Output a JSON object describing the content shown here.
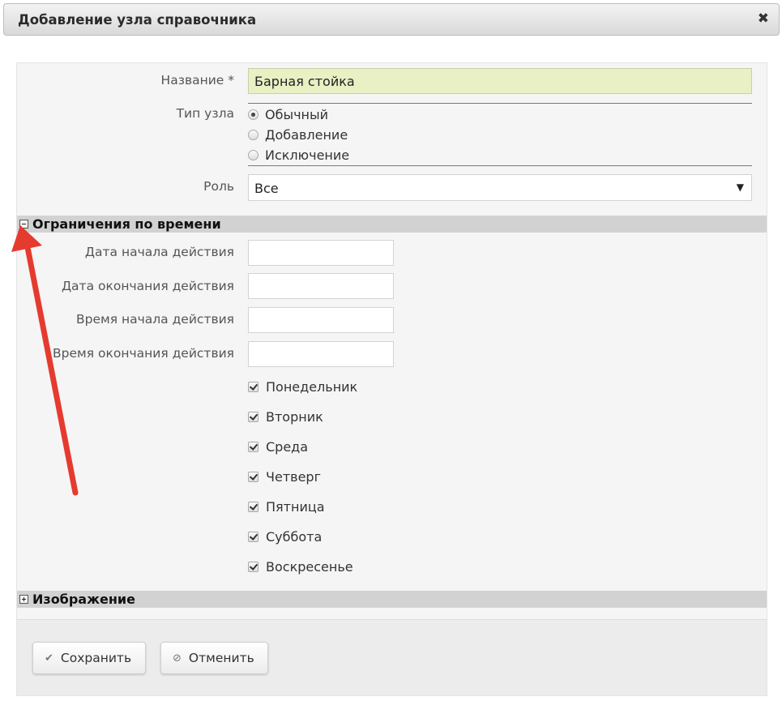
{
  "dialog": {
    "title": "Добавление узла справочника",
    "close_glyph": "✖"
  },
  "form": {
    "name_label": "Название *",
    "name_value": "Барная стойка",
    "node_type_label": "Тип узла",
    "node_type_options": [
      "Обычный",
      "Добавление",
      "Исключение"
    ],
    "node_type_selected": "Обычный",
    "role_label": "Роль",
    "role_value": "Все"
  },
  "time_section": {
    "title": "Ограничения по времени",
    "expanded": true,
    "start_date_label": "Дата начала действия",
    "end_date_label": "Дата окончания действия",
    "start_time_label": "Время начала действия",
    "end_time_label": "Время окончания действия",
    "days": [
      {
        "label": "Понедельник",
        "checked": true
      },
      {
        "label": "Вторник",
        "checked": true
      },
      {
        "label": "Среда",
        "checked": true
      },
      {
        "label": "Четверг",
        "checked": true
      },
      {
        "label": "Пятница",
        "checked": true
      },
      {
        "label": "Суббота",
        "checked": true
      },
      {
        "label": "Воскресенье",
        "checked": true
      }
    ]
  },
  "image_section": {
    "title": "Изображение",
    "expanded": false
  },
  "buttons": {
    "save_label": "Сохранить",
    "save_icon": "check-icon",
    "cancel_label": "Отменить",
    "cancel_icon": "cancel-icon"
  },
  "colors": {
    "name_field_bg": "#e8f0c4",
    "section_bar": "#d2d2d2",
    "annotation_arrow": "#e53b2f"
  }
}
